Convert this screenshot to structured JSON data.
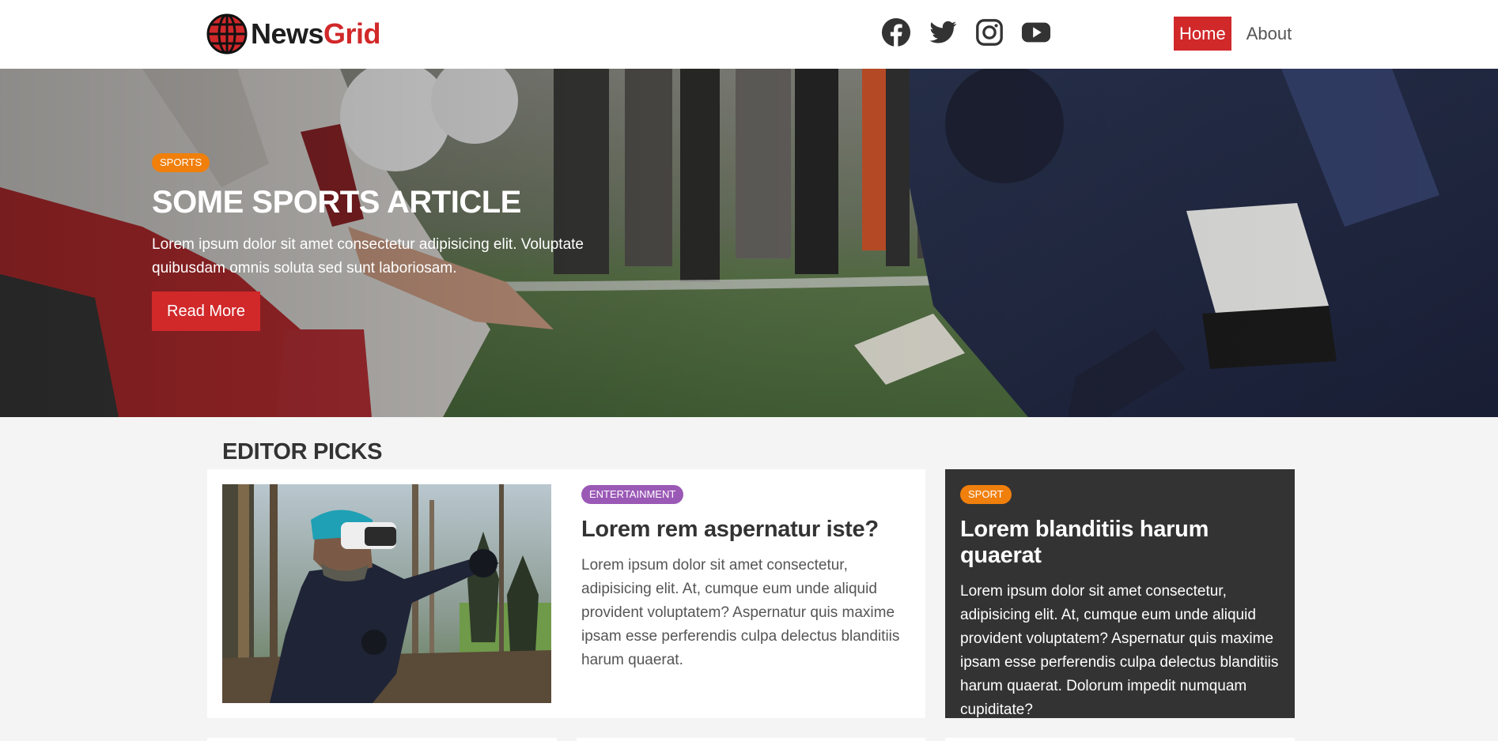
{
  "brand": {
    "name_part1": "News",
    "name_part2": "Grid"
  },
  "social": [
    {
      "icon": "facebook-icon"
    },
    {
      "icon": "twitter-icon"
    },
    {
      "icon": "instagram-icon"
    },
    {
      "icon": "youtube-icon"
    }
  ],
  "nav": {
    "home": "Home",
    "about": "About"
  },
  "hero": {
    "category": "SPORTS",
    "title": "SOME SPORTS ARTICLE",
    "text": "Lorem ipsum dolor sit amet consectetur adipisicing elit. Voluptate quibusdam omnis soluta sed sunt laboriosam.",
    "button": "Read More"
  },
  "editor_picks": {
    "heading": "EDITOR PICKS",
    "main_card": {
      "category": "ENTERTAINMENT",
      "title": "Lorem rem aspernatur iste?",
      "text": "Lorem ipsum dolor sit amet consectetur, adipisicing elit. At, cumque eum unde aliquid provident voluptatem? Aspernatur quis maxime ipsam esse perferendis culpa delectus blanditiis harum quaerat."
    },
    "side_card": {
      "category": "SPORT",
      "title": "Lorem blanditiis harum quaerat",
      "text": "Lorem ipsum dolor sit amet consectetur, adipisicing elit. At, cumque eum unde aliquid provident voluptatem? Aspernatur quis maxime ipsam esse perferendis culpa delectus blanditiis harum quaerat. Dolorum impedit numquam cupiditate?"
    }
  },
  "colors": {
    "accent": "#d1282a",
    "sport_badge": "#f07f0c",
    "entertainment_badge": "#9b59b6",
    "dark_card": "#333333"
  }
}
